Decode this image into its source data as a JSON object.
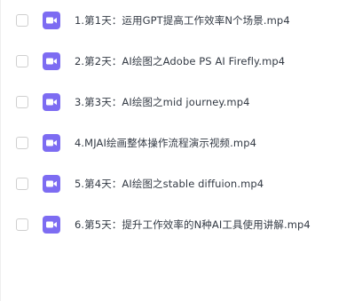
{
  "files": [
    {
      "name": "1.第1天：运用GPT提高工作效率N个场景.mp4",
      "icon": "video-file-icon"
    },
    {
      "name": "2.第2天：AI绘图之Adobe PS AI Firefly.mp4",
      "icon": "video-file-icon"
    },
    {
      "name": "3.第3天：AI绘图之mid journey.mp4",
      "icon": "video-file-icon"
    },
    {
      "name": "4.MJAI绘画整体操作流程演示视频.mp4",
      "icon": "video-file-icon"
    },
    {
      "name": "5.第4天：AI绘图之stable diffuion.mp4",
      "icon": "video-file-icon"
    },
    {
      "name": "6.第5天：提升工作效率的N种AI工具使用讲解.mp4",
      "icon": "video-file-icon"
    }
  ],
  "colors": {
    "icon_bg": "#7d6cf2",
    "text": "#333a44",
    "checkbox_border": "#cfcfcf"
  }
}
